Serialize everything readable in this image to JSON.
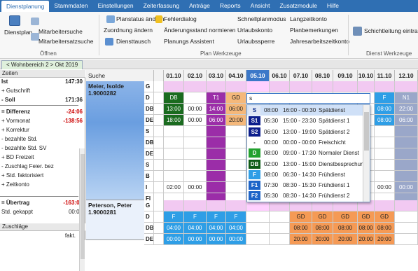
{
  "menu": [
    "Dienstplanung",
    "Stammdaten",
    "Einstellungen",
    "Zeiterfassung",
    "Anträge",
    "Reports",
    "Ansicht",
    "Zusatzmodule",
    "Hilfe"
  ],
  "ribbon": {
    "dienstplan": "Dienstplan",
    "mitarbeitersuche": "Mitarbeitersuche",
    "mitarbeitersatzsuche": "Mitarbeitersatzsuche",
    "group_oeffnen": "Öffnen",
    "planstatus": "Planstatus ändern",
    "fehlerdialog": "Fehlerdialog",
    "schnellplanmodus": "Schnellplanmodus",
    "langzeitkonto": "Langzeitkonto",
    "zuordnung": "Zuordnung ändern",
    "aenderungsstand": "Änderungsstand normieren",
    "urlaubskonto": "Urlaubskonto",
    "planbemerkungen": "Planbemerkungen",
    "diensttausch": "Diensttausch",
    "planungsassistent": "Planungs Assistent",
    "urlaubssperre": "Urlaubssperre",
    "jahresarbeitszeitkonto": "Jahresarbeitszeitkonto",
    "group_planwerkzeuge": "Plan Werkzeuge",
    "schichtleitung": "Schichtleitung eintra",
    "group_dienstwerkzeuge": "Dienst Werkzeuge"
  },
  "tab": {
    "label": "< Wohnbereich 2 > Okt 2019"
  },
  "left": {
    "header": "Zeiten",
    "rows": [
      {
        "l": "Ist",
        "v": "147:30",
        "b": true
      },
      {
        "l": "+ Gutschrift",
        "v": ""
      },
      {
        "l": "- Soll",
        "v": "171:36",
        "b": true
      },
      {
        "l": "= Differenz",
        "v": "-24:06",
        "b": true,
        "red": true
      },
      {
        "l": "+ Vormonat",
        "v": "-138:56",
        "red": true
      },
      {
        "l": "+ Korrektur",
        "v": ""
      },
      {
        "l": "- bezahlte Std.",
        "v": ""
      },
      {
        "l": "- bezahlte Std. SV",
        "v": ""
      },
      {
        "l": "+ BD Freizeit",
        "v": ""
      },
      {
        "l": "- Zuschlag Feier. bez",
        "v": ""
      },
      {
        "l": "+ Std. faktorisiert",
        "v": ""
      },
      {
        "l": "+ Zeitkonto",
        "v": ""
      },
      {
        "l": "= Übertrag",
        "v": "-163:02",
        "b": true,
        "red": true
      },
      {
        "l": "Std. gekappt",
        "v": "00:00"
      }
    ],
    "zuschlaege": "Zuschläge",
    "fakt": "fakt."
  },
  "grid": {
    "search": "Suche",
    "dates": [
      "01.10",
      "02.10",
      "03.10",
      "04.10",
      "05.10",
      "06.10",
      "07.10",
      "08.10",
      "09.10",
      "10.10",
      "11.10",
      "12.10"
    ],
    "p1": {
      "name": "Meier, Isolde",
      "id": "1.9000282"
    },
    "p2": {
      "name": "Peterson, Peter",
      "id": "1.9000281"
    },
    "types1": [
      "G",
      "D",
      "DB",
      "DE",
      "S",
      "DB",
      "DE",
      "S",
      "B",
      "I",
      "FI"
    ],
    "types2": [
      "G",
      "D",
      "DB",
      "DE"
    ],
    "d1": [
      "DB",
      "",
      "T1",
      "GD",
      "S",
      "",
      "",
      "",
      "",
      "",
      "F",
      "N1"
    ],
    "db1": [
      "13:00",
      "00:00",
      "14:00",
      "06:00",
      "",
      "",
      "",
      "",
      "",
      "",
      "08:00",
      "22:00"
    ],
    "de1": [
      "18:00",
      "00:00",
      "06:00",
      "20:00",
      "",
      "",
      "",
      "",
      "",
      "",
      "08:00",
      "06:00"
    ],
    "i1": [
      "02:00",
      "00:00",
      "",
      "",
      "",
      "",
      "",
      "",
      "",
      "",
      "00:00",
      "00:00"
    ],
    "d2": [
      "F",
      "F",
      "F",
      "F",
      "",
      "",
      "GD",
      "GD",
      "GD",
      "GD",
      "GD",
      ""
    ],
    "db2": [
      "04:00",
      "04:00",
      "04:00",
      "04:00",
      "",
      "",
      "08:00",
      "08:00",
      "08:00",
      "08:00",
      "08:00",
      ""
    ],
    "de2": [
      "00:00",
      "00:00",
      "00:00",
      "00:00",
      "",
      "",
      "20:00",
      "20:00",
      "20:00",
      "20:00",
      "20:00",
      ""
    ]
  },
  "input": {
    "value": "s"
  },
  "dropdown": [
    {
      "b": "S",
      "s": "08:00",
      "t": "16:00 - 00:30",
      "n": "Spätdienst",
      "bg": "#dfe7f5",
      "fg": "#0b2a8a"
    },
    {
      "b": "S1",
      "s": "05:30",
      "t": "15:00 - 23:30",
      "n": "Spätdienst 1",
      "bg": "#0c1e8c",
      "fg": "#fff"
    },
    {
      "b": "S2",
      "s": "06:00",
      "t": "13:00 - 19:00",
      "n": "Spätdienst 2",
      "bg": "#0c1e8c",
      "fg": "#fff"
    },
    {
      "b": "-",
      "s": "00:00",
      "t": "00:00 - 00:00",
      "n": "Freischicht",
      "bg": "#fff",
      "fg": "#222"
    },
    {
      "b": "D",
      "s": "08:00",
      "t": "09:00 - 17:30",
      "n": "Normaler Dienst",
      "bg": "#23a12f",
      "fg": "#fff"
    },
    {
      "b": "DB",
      "s": "02:00",
      "t": "13:00 - 15:00",
      "n": "Dienstbesprechun",
      "bg": "#0e5c17",
      "fg": "#fff"
    },
    {
      "b": "F",
      "s": "08:00",
      "t": "06:30 - 14:30",
      "n": "Frühdienst",
      "bg": "#2e9ee6",
      "fg": "#fff"
    },
    {
      "b": "F1",
      "s": "07:30",
      "t": "08:30 - 15:30",
      "n": "Frühdienst 1",
      "bg": "#1d64c8",
      "fg": "#fff"
    },
    {
      "b": "F2",
      "s": "05:30",
      "t": "08:30 - 14:30",
      "n": "Frühdienst 2",
      "bg": "#1d64c8",
      "fg": "#fff"
    }
  ]
}
